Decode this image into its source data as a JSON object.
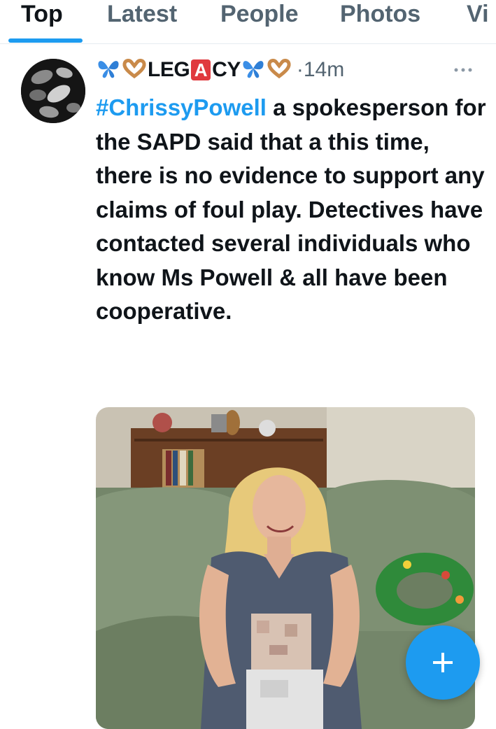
{
  "tabs": [
    {
      "label": "Top",
      "active": true
    },
    {
      "label": "Latest"
    },
    {
      "label": "People"
    },
    {
      "label": "Photos"
    },
    {
      "label": "Vi"
    }
  ],
  "tweet": {
    "author": {
      "name_part1": "LEG",
      "name_badge": "A",
      "name_part2": "CY",
      "avatar_icon": "avatar-image",
      "emoji_left": [
        "butterfly-icon",
        "heart-hands-icon"
      ],
      "emoji_right": [
        "butterfly-icon",
        "heart-hands-icon"
      ]
    },
    "time": "·14m",
    "hashtag": "#ChrissyPowell",
    "text_after_hashtag": " a spokesperson for the SAPD said that a this time, there is no evidence to support any claims of foul play. Detectives have contacted several individuals who know Ms Powell & all have been cooperative.",
    "more_icon": "more-dots-icon",
    "photo_icon": "tweet-photo"
  },
  "fab": {
    "icon": "plus-icon"
  },
  "colors": {
    "accent": "#1d9bf0",
    "text": "#0f1419",
    "muted": "#536471"
  }
}
